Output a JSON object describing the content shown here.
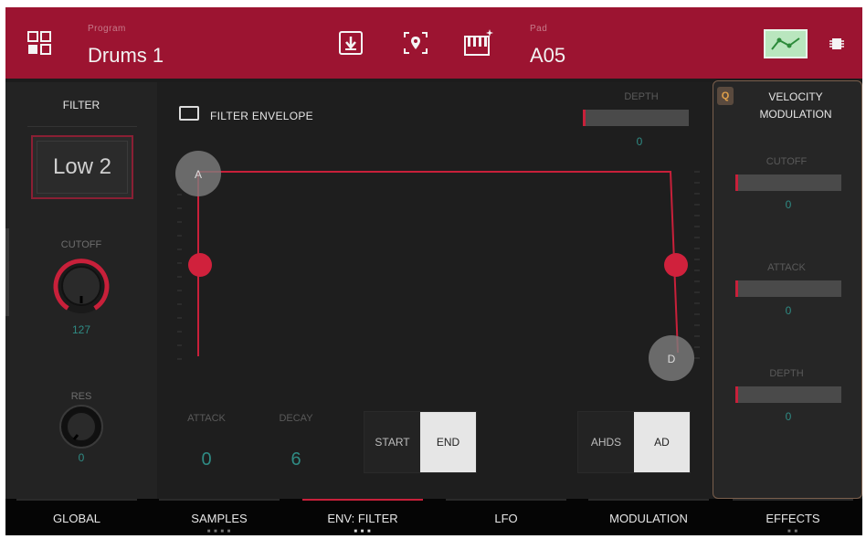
{
  "header": {
    "program_label": "Program",
    "program_name": "Drums 1",
    "pad_label": "Pad",
    "pad_name": "A05",
    "icons": [
      "grid-icon",
      "save-download-icon",
      "locate-icon",
      "keyboard-icon",
      "envelope-toggle-icon",
      "chip-icon"
    ]
  },
  "left": {
    "filter_label": "FILTER",
    "filter_type": "Low 2",
    "cutoff_label": "CUTOFF",
    "cutoff_value": "127",
    "res_label": "RES",
    "res_value": "0"
  },
  "envelope": {
    "title": "FILTER ENVELOPE",
    "depth_label": "DEPTH",
    "depth_value": "0",
    "handle_a": "A",
    "handle_d": "D",
    "attack_label": "ATTACK",
    "attack_value": "0",
    "decay_label": "DECAY",
    "decay_value": "6",
    "trigger_options": [
      "START",
      "END"
    ],
    "trigger_selected": "END",
    "type_options": [
      "AHDS",
      "AD"
    ],
    "type_selected": "AD"
  },
  "velocity": {
    "badge": "Q",
    "title_line1": "VELOCITY",
    "title_line2": "MODULATION",
    "cutoff_label": "CUTOFF",
    "cutoff_value": "0",
    "attack_label": "ATTACK",
    "attack_value": "0",
    "depth_label": "DEPTH",
    "depth_value": "0"
  },
  "tabs": [
    {
      "label": "GLOBAL",
      "dots": ""
    },
    {
      "label": "SAMPLES",
      "dots": "■ ■ ■ ■"
    },
    {
      "label": "ENV: FILTER",
      "dots": "■ ■ ■"
    },
    {
      "label": "LFO",
      "dots": ""
    },
    {
      "label": "MODULATION",
      "dots": ""
    },
    {
      "label": "EFFECTS",
      "dots": "■ ■"
    }
  ],
  "active_tab": "ENV: FILTER",
  "colors": {
    "header_bg": "#9c1431",
    "accent_red": "#c8203a",
    "value_teal": "#2f8b84",
    "toggle_green": "#b9e6be",
    "panel_border": "#7a5f4d"
  }
}
